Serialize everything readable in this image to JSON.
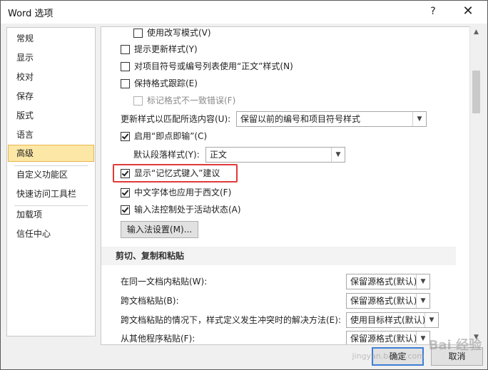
{
  "window": {
    "title": "Word 选项",
    "help_label": "?",
    "close_label": "✕"
  },
  "nav": {
    "items": [
      "常规",
      "显示",
      "校对",
      "保存",
      "版式",
      "语言",
      "高级",
      "自定义功能区",
      "快速访问工具栏",
      "加载项",
      "信任中心"
    ],
    "active": "高级"
  },
  "options": {
    "cut_top_label": "使用改写模式(V)",
    "prompt_update_style": "提示更新样式(Y)",
    "normal_style_for_lists": "对项目符号或编号列表使用“正文”样式(N)",
    "keep_track_formatting": "保持格式跟踪(E)",
    "mark_format_inconsistencies": "标记格式不一致错误(F)",
    "update_style_label": "更新样式以匹配所选内容(U):",
    "update_style_value": "保留以前的编号和项目符号样式",
    "enable_click_and_type": "启用“即点即输”(C)",
    "default_para_style_label": "默认段落样式(Y):",
    "default_para_style_value": "正文",
    "show_autocomplete": "显示“记忆式键入”建议",
    "cjk_font_for_western": "中文字体也应用于西文(F)",
    "ime_active": "输入法控制处于活动状态(A)",
    "ime_settings_button": "输入法设置(M)..."
  },
  "cut_copy_paste": {
    "header": "剪切、复制和粘贴",
    "rows": [
      {
        "label": "在同一文档内粘贴(W):",
        "value": "保留源格式(默认)"
      },
      {
        "label": "跨文档粘贴(B):",
        "value": "保留源格式(默认)"
      },
      {
        "label": "跨文档粘贴的情况下，样式定义发生冲突时的解决方法(E):",
        "value": "使用目标样式(默认)"
      },
      {
        "label": "从其他程序粘贴(F):",
        "value": "保留源格式(默认)"
      }
    ]
  },
  "footer": {
    "ok": "确定",
    "cancel": "取消"
  },
  "watermark": {
    "main": "Bai 经验",
    "sub": "jingyan.baidu.com"
  },
  "colors": {
    "accent": "#3c7fd6",
    "highlight": "#e03a3a",
    "active_nav": "#fde7a6"
  }
}
